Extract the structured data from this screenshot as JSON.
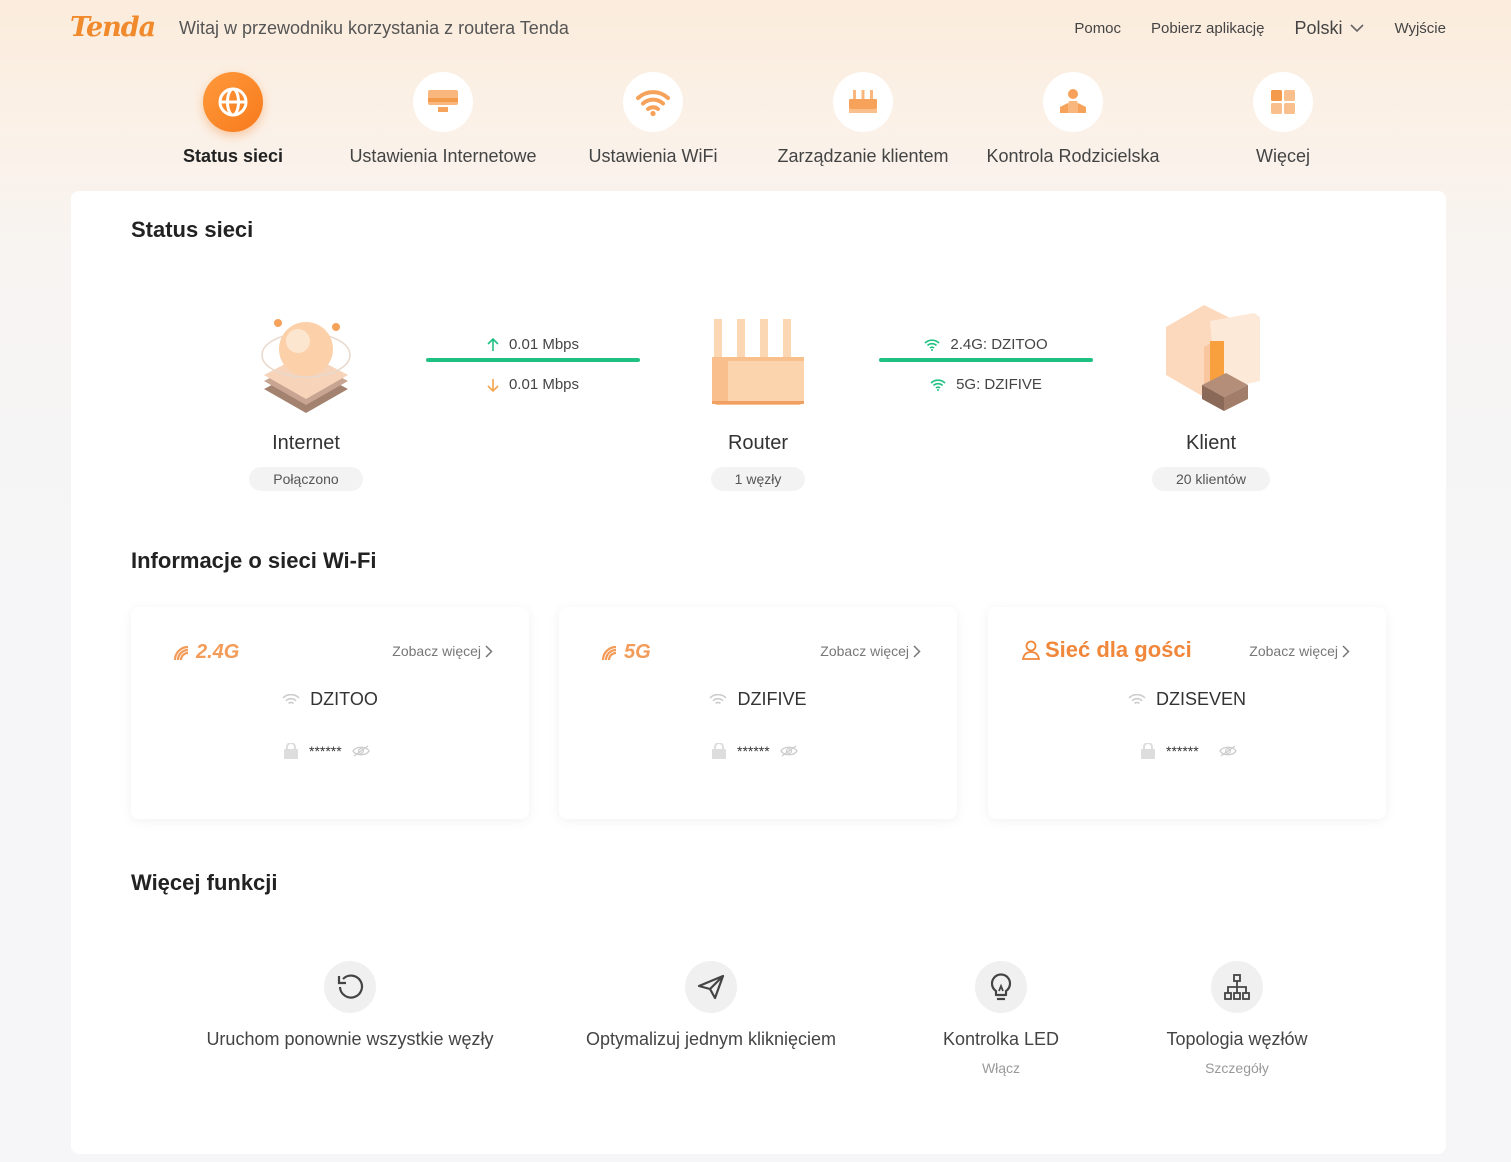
{
  "header": {
    "logo": "Tenda",
    "welcome": "Witaj w przewodniku korzystania z routera Tenda",
    "nav": {
      "help": "Pomoc",
      "download": "Pobierz aplikację",
      "language": "Polski",
      "logout": "Wyjście"
    }
  },
  "tabs": [
    {
      "label": "Status sieci",
      "icon": "globe-icon",
      "active": true
    },
    {
      "label": "Ustawienia Internetowe",
      "icon": "monitor-icon",
      "active": false
    },
    {
      "label": "Ustawienia WiFi",
      "icon": "wifi-icon",
      "active": false
    },
    {
      "label": "Zarządzanie klientem",
      "icon": "router-icon",
      "active": false
    },
    {
      "label": "Kontrola Rodzicielska",
      "icon": "parental-icon",
      "active": false
    },
    {
      "label": "Więcej",
      "icon": "grid-icon",
      "active": false
    }
  ],
  "status": {
    "title": "Status sieci",
    "internet": {
      "name": "Internet",
      "state": "Połączono"
    },
    "upload": "0.01 Mbps",
    "download": "0.01 Mbps",
    "router": {
      "name": "Router",
      "state": "1 węzły"
    },
    "wifi_24": "2.4G: DZITOO",
    "wifi_5": "5G: DZIFIVE",
    "client": {
      "name": "Klient",
      "state": "20 klientów"
    }
  },
  "wifi_info": {
    "title": "Informacje o sieci Wi-Fi",
    "cards": [
      {
        "band": "2.4G",
        "more": "Zobacz więcej",
        "ssid": "DZITOO",
        "password": "******"
      },
      {
        "band": "5G",
        "more": "Zobacz więcej",
        "ssid": "DZIFIVE",
        "password": "******"
      },
      {
        "band": "Sieć dla gości",
        "more": "Zobacz więcej",
        "ssid": "DZISEVEN",
        "password": "******"
      }
    ]
  },
  "functions": {
    "title": "Więcej funkcji",
    "items": [
      {
        "label": "Uruchom ponownie wszystkie węzły",
        "sub": "",
        "icon": "restart-icon"
      },
      {
        "label": "Optymalizuj jednym kliknięciem",
        "sub": "",
        "icon": "paper-plane-icon"
      },
      {
        "label": "Kontrolka LED",
        "sub": "Włącz",
        "icon": "bulb-icon"
      },
      {
        "label": "Topologia węzłów",
        "sub": "Szczegóły",
        "icon": "topology-icon"
      }
    ]
  },
  "colors": {
    "accent": "#f77a1c",
    "link": "#1fc182",
    "guest": "#f0873a"
  }
}
